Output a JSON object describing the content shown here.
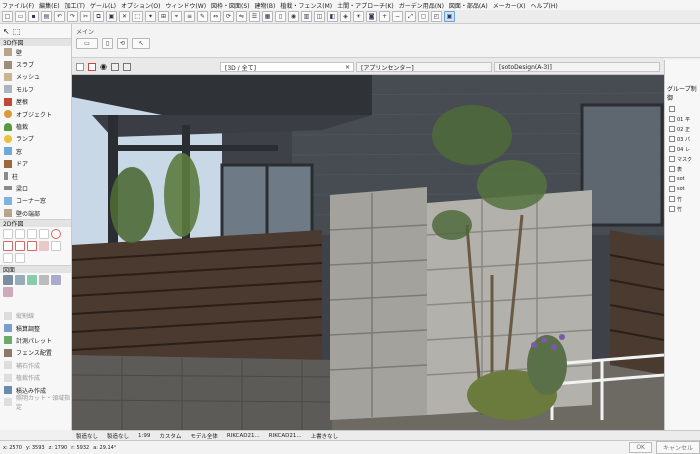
{
  "menu": [
    "ファイル(F)",
    "編集(E)",
    "加工(T)",
    "ゲール(L)",
    "オプション(O)",
    "ウィンドウ(W)",
    "図枠・図面(S)",
    "建物(B)",
    "植栽・フェンス(M)",
    "土間・アプローチ(K)",
    "ガーデン用品(N)",
    "図面・部品(A)",
    "メーカー(X)",
    "ヘルプ(H)"
  ],
  "infobox": {
    "label": "メイン"
  },
  "tabs": {
    "tab1": "[3D / 全て]",
    "tab2": "[アプリンセンター]",
    "tab3": "[sotoDesign(A-3)]"
  },
  "left": {
    "section_3d": "3D作図",
    "tools": [
      "壁",
      "スラブ",
      "メッシュ",
      "モルフ",
      "屋根",
      "オブジェクト",
      "植栽",
      "ランプ",
      "窓",
      "ドア",
      "柱",
      "梁ロ",
      "コーナー窓",
      "壁の端部"
    ],
    "section_2d": "2D作図",
    "section_fig": "図面",
    "bottom_items": [
      "縦割線",
      "積算調整",
      "計測パレット",
      "フェンス配置",
      "補石作成",
      "植栽作成",
      "積込み作成",
      "照明カット・領域指定"
    ]
  },
  "right": {
    "title": "グループ制御",
    "tree": [
      "",
      "01 平",
      "02 正",
      "03 パ",
      "04 レ",
      "マスク",
      "表",
      "sot",
      "sot",
      "竹",
      "竹"
    ]
  },
  "status": [
    "製造なし",
    "製造なし",
    "1:99",
    "カスタム",
    "モデル全体",
    "RIKCAD21...",
    "RIKCAD21...",
    "上書きなし"
  ],
  "coord": {
    "x": "2570",
    "y": "3593",
    "z": "1790",
    "dx": "5932",
    "angle": "29.14°"
  },
  "buttons": {
    "ok": "OK",
    "cancel": "キャンセル"
  }
}
